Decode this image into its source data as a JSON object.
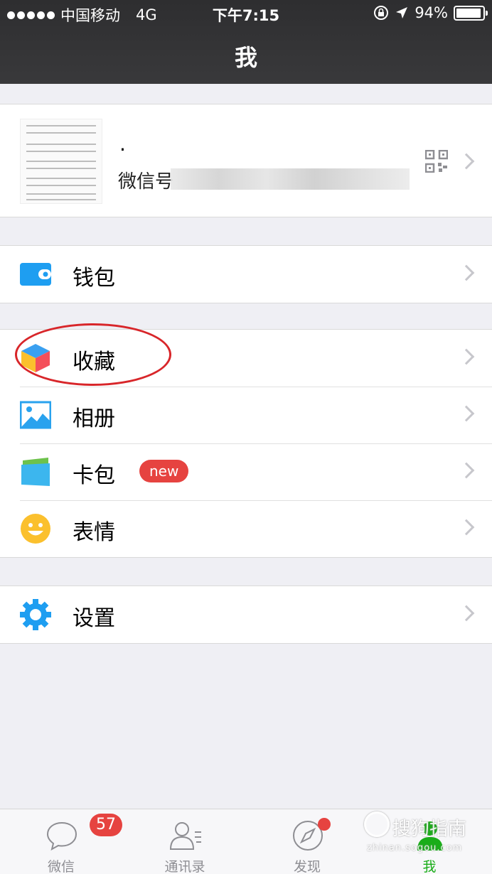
{
  "status_bar": {
    "carrier": "中国移动",
    "network": "4G",
    "time": "下午7:15",
    "battery_text": "94%",
    "battery_level": 0.94
  },
  "nav": {
    "title": "我"
  },
  "profile": {
    "nickname": ".",
    "wechat_id_label": "微信号"
  },
  "menu_groups": {
    "wallet": {
      "label": "钱包"
    },
    "favorites": {
      "label": "收藏"
    },
    "album": {
      "label": "相册"
    },
    "card_pack": {
      "label": "卡包",
      "badge": "new"
    },
    "stickers": {
      "label": "表情"
    },
    "settings": {
      "label": "设置"
    }
  },
  "tabbar": {
    "chats": {
      "label": "微信",
      "badge": "57"
    },
    "contacts": {
      "label": "通讯录"
    },
    "discover": {
      "label": "发现"
    },
    "me": {
      "label": "我"
    }
  },
  "watermark": {
    "text": "搜狗指南",
    "url": "zhinan.sogou.com"
  },
  "colors": {
    "accent_green": "#1aad19",
    "badge_red": "#e64340",
    "highlight_red": "#d8262a",
    "nav_bg": "#39393b",
    "page_bg": "#efeff4"
  }
}
